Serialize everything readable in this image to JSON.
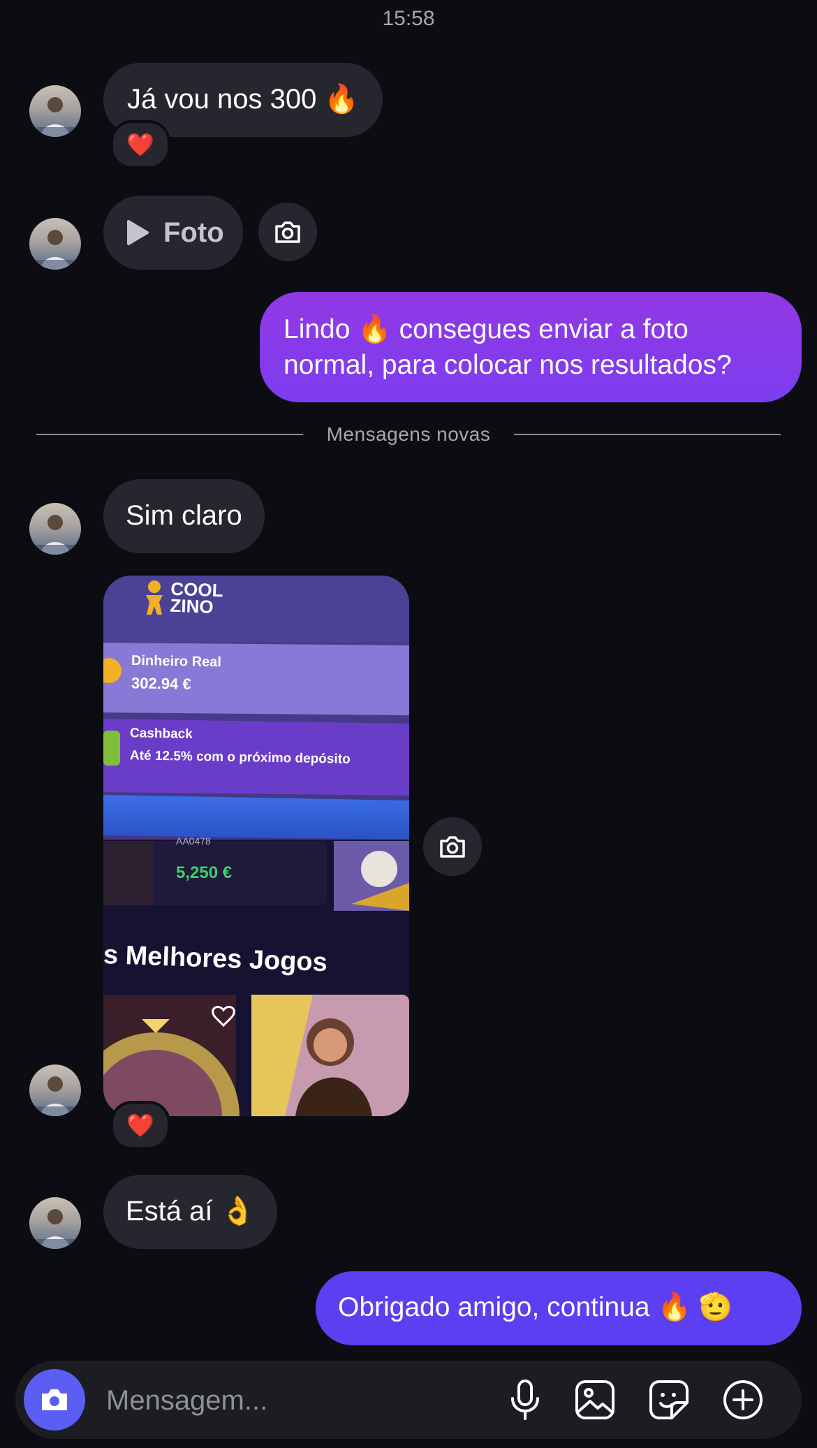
{
  "header": {
    "timestamp": "15:58"
  },
  "messages": {
    "m1": {
      "text": "Já vou nos 300 🔥",
      "reaction": "❤️"
    },
    "m2": {
      "label": "Foto"
    },
    "m3": {
      "text_line1": "Lindo 🔥 consegues enviar a foto",
      "text_line2": "normal, para colocar nos resultados?"
    },
    "divider": {
      "label": "Mensagens novas"
    },
    "m4": {
      "text": "Sim claro"
    },
    "photo": {
      "brand_line1": "COOL",
      "brand_line2": "ZINO",
      "balance_label": "Dinheiro Real",
      "balance_value": "302.94 €",
      "cashback_label": "Cashback",
      "cashback_text": "Até 12.5% com o próximo depósito",
      "ticket_id": "AA0478",
      "win_value": "5,250 €",
      "section_title": "s Melhores Jogos",
      "reaction": "❤️"
    },
    "m5": {
      "text": "Está aí 👌"
    },
    "m6": {
      "text": "Obrigado amigo, continua 🔥 🫡"
    }
  },
  "composer": {
    "placeholder": "Mensagem..."
  },
  "colors": {
    "background": "#0c0d12",
    "incoming_bubble": "#26272e",
    "outgoing_purple": "#8a3be6",
    "outgoing_indigo": "#5b3ff0",
    "camera_button": "#5b5ef3"
  },
  "icons": [
    "camera-icon",
    "play-icon",
    "heart-icon",
    "microphone-icon",
    "gallery-icon",
    "sticker-icon",
    "plus-icon"
  ]
}
